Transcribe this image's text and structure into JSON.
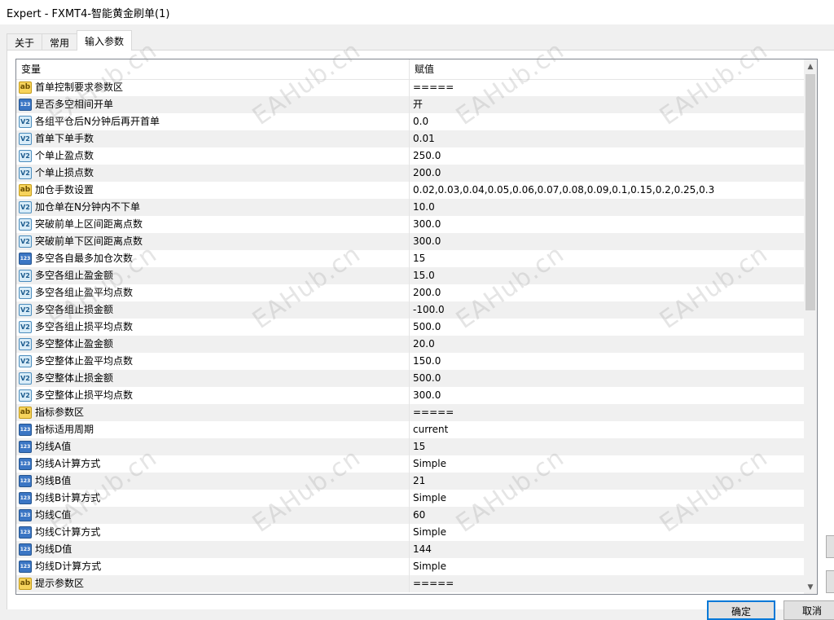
{
  "window": {
    "title": "Expert - FXMT4-智能黄金刷单(1)"
  },
  "tabs": [
    {
      "label": "关于"
    },
    {
      "label": "常用"
    },
    {
      "label": "输入参数"
    }
  ],
  "grid": {
    "columns": {
      "variable": "变量",
      "value": "赋值"
    },
    "rows": [
      {
        "type": "ab",
        "name": "首单控制要求参数区",
        "value": "====="
      },
      {
        "type": "123",
        "name": "是否多空相间开单",
        "value": "开"
      },
      {
        "type": "v2",
        "name": "各组平仓后N分钟后再开首单",
        "value": "0.0"
      },
      {
        "type": "v2",
        "name": "首单下单手数",
        "value": "0.01"
      },
      {
        "type": "v2",
        "name": "个单止盈点数",
        "value": "250.0"
      },
      {
        "type": "v2",
        "name": "个单止损点数",
        "value": "200.0"
      },
      {
        "type": "ab",
        "name": "加仓手数设置",
        "value": "0.02,0.03,0.04,0.05,0.06,0.07,0.08,0.09,0.1,0.15,0.2,0.25,0.3"
      },
      {
        "type": "v2",
        "name": "加仓单在N分钟内不下单",
        "value": "10.0"
      },
      {
        "type": "v2",
        "name": "突破前单上区间距离点数",
        "value": "300.0"
      },
      {
        "type": "v2",
        "name": "突破前单下区间距离点数",
        "value": "300.0"
      },
      {
        "type": "123",
        "name": "多空各自最多加仓次数",
        "value": "15"
      },
      {
        "type": "v2",
        "name": "多空各组止盈金额",
        "value": "15.0"
      },
      {
        "type": "v2",
        "name": "多空各组止盈平均点数",
        "value": "200.0"
      },
      {
        "type": "v2",
        "name": "多空各组止损金额",
        "value": "-100.0"
      },
      {
        "type": "v2",
        "name": "多空各组止损平均点数",
        "value": "500.0"
      },
      {
        "type": "v2",
        "name": "多空整体止盈金额",
        "value": "20.0"
      },
      {
        "type": "v2",
        "name": "多空整体止盈平均点数",
        "value": "150.0"
      },
      {
        "type": "v2",
        "name": "多空整体止损金额",
        "value": "500.0"
      },
      {
        "type": "v2",
        "name": "多空整体止损平均点数",
        "value": "300.0"
      },
      {
        "type": "ab",
        "name": "指标参数区",
        "value": "====="
      },
      {
        "type": "123",
        "name": "指标适用周期",
        "value": "current"
      },
      {
        "type": "123",
        "name": "均线A值",
        "value": "15"
      },
      {
        "type": "123",
        "name": "均线A计算方式",
        "value": "Simple"
      },
      {
        "type": "123",
        "name": "均线B值",
        "value": "21"
      },
      {
        "type": "123",
        "name": "均线B计算方式",
        "value": "Simple"
      },
      {
        "type": "123",
        "name": "均线C值",
        "value": "60"
      },
      {
        "type": "123",
        "name": "均线C计算方式",
        "value": "Simple"
      },
      {
        "type": "123",
        "name": "均线D值",
        "value": "144"
      },
      {
        "type": "123",
        "name": "均线D计算方式",
        "value": "Simple"
      },
      {
        "type": "ab",
        "name": "提示参数区",
        "value": "====="
      }
    ]
  },
  "watermark": {
    "text": "EAHub.cn"
  },
  "buttons": {
    "ok": "确定",
    "cancel": "取消"
  }
}
